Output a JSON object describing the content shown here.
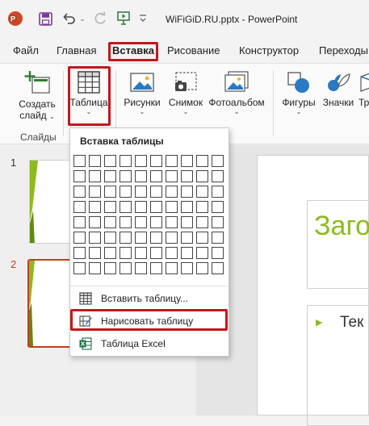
{
  "title": "WiFiGiD.RU.pptx  -  PowerPoint",
  "tabs": [
    "Файл",
    "Главная",
    "Вставка",
    "Рисование",
    "Конструктор",
    "Переходы"
  ],
  "active_tab": "Вставка",
  "ribbon": {
    "new_slide_line1": "Создать",
    "new_slide_line2": "слайд",
    "table": "Таблица",
    "pictures": "Рисунки",
    "screenshot": "Снимок",
    "photo_album": "Фотоальбом",
    "shapes": "Фигуры",
    "icons": "Значки",
    "next_cut": "Тр",
    "slides_group": "Слайды"
  },
  "dropdown": {
    "title": "Вставка таблицы",
    "grid_cols": 10,
    "grid_rows": 8,
    "insert_table": "Вставить таблицу...",
    "draw_table": "Нарисовать таблицу",
    "excel_table": "Таблица Excel"
  },
  "slides": {
    "num1": "1",
    "num2": "2",
    "main_title_fragment": "Заго",
    "bullet_fragment": "Тек"
  },
  "colors": {
    "accent_red": "#c4161c",
    "slide_green": "#8cbb1e",
    "ppt_orange": "#c43e1c"
  }
}
